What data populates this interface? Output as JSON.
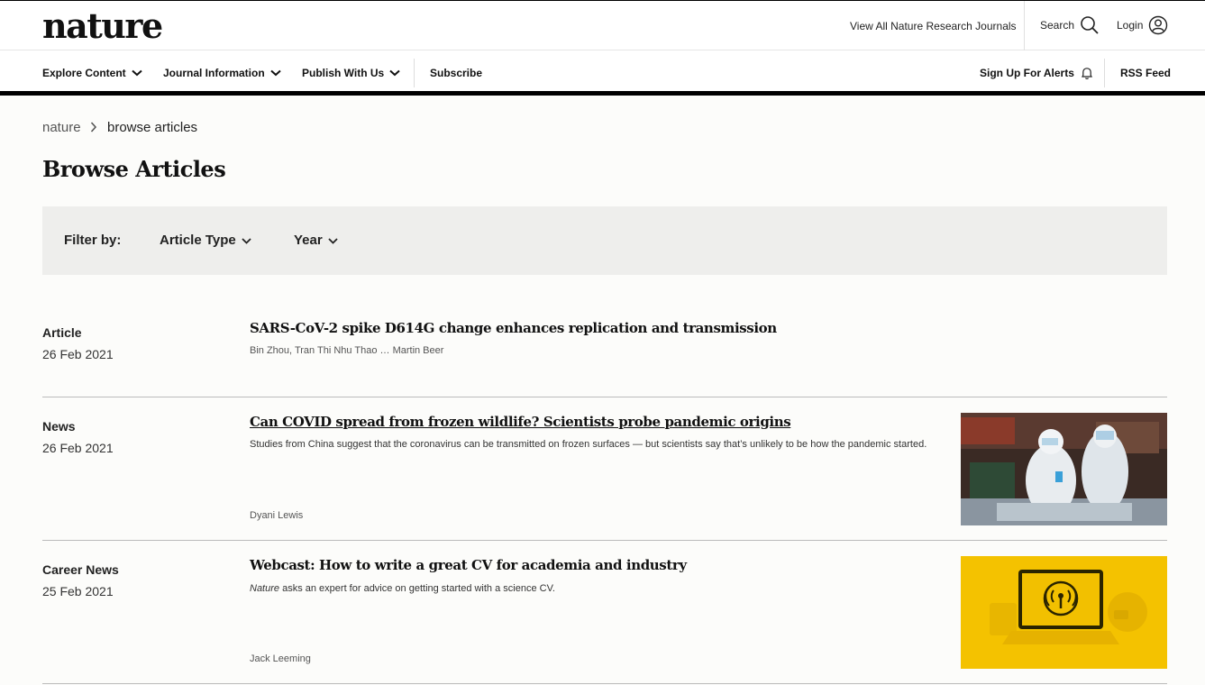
{
  "header": {
    "logo": "nature",
    "view_all": "View All Nature Research Journals",
    "search": "Search",
    "login": "Login"
  },
  "nav": {
    "explore": "Explore Content",
    "journal_info": "Journal Information",
    "publish": "Publish With Us",
    "subscribe": "Subscribe",
    "alerts": "Sign Up For Alerts",
    "rss": "RSS Feed"
  },
  "breadcrumb": {
    "home": "nature",
    "current": "browse articles"
  },
  "page_title": "Browse Articles",
  "filter": {
    "label": "Filter by:",
    "article_type": "Article Type",
    "year": "Year"
  },
  "articles": [
    {
      "type": "Article",
      "date": "26 Feb 2021",
      "title": "SARS-CoV-2 spike D614G change enhances replication and transmission",
      "description": "",
      "authors": "Bin Zhou, Tran Thi Nhu Thao … Martin Beer"
    },
    {
      "type": "News",
      "date": "26 Feb 2021",
      "title": "Can COVID spread from frozen wildlife? Scientists probe pandemic origins",
      "description": "Studies from China suggest that the coronavirus can be transmitted on frozen surfaces — but scientists say that’s unlikely to be how the pandemic started.",
      "authors": "Dyani Lewis"
    },
    {
      "type": "Career News",
      "date": "25 Feb 2021",
      "title": "Webcast: How to write a great CV for academia and industry",
      "description_italic": "Nature",
      "description": " asks an expert for advice on getting started with a science CV.",
      "authors": "Jack Leeming"
    }
  ],
  "colors": {
    "accent": "#000000",
    "filter_bg": "#eeeeec",
    "webcast_yellow": "#f4c200"
  }
}
